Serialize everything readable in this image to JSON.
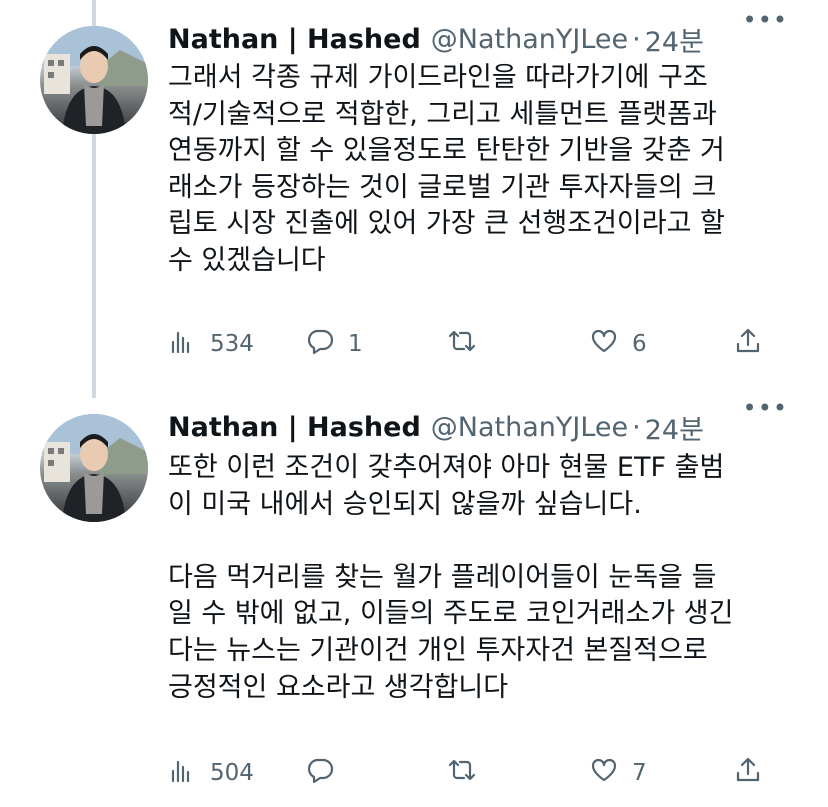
{
  "tweets": [
    {
      "author": {
        "name": "Nathan | Hashed",
        "handle": "@NathanYJLee"
      },
      "separator": "·",
      "time": "24분",
      "text": "그래서 각종 규제 가이드라인을 따라가기에 구조\n적/기술적으로 적합한, 그리고 세틀먼트 플랫폼과\n연동까지 할 수 있을정도로 탄탄한 기반을 갖춘 거\n래소가 등장하는 것이 글로벌 기관 투자자들의 크\n립토 시장 진출에 있어 가장 큰 선행조건이라고 할\n수 있겠습니다",
      "metrics": {
        "views": "534",
        "replies": "1",
        "retweets": "",
        "likes": "6"
      },
      "icons": {
        "views": "bar-chart-icon",
        "reply": "comment-icon",
        "retweet": "retweet-icon",
        "like": "heart-icon",
        "share": "share-icon",
        "more": "more-icon"
      }
    },
    {
      "author": {
        "name": "Nathan | Hashed",
        "handle": "@NathanYJLee"
      },
      "separator": "·",
      "time": "24분",
      "text": "또한 이런 조건이 갖추어져야 아마 현물 ETF 출범\n이 미국 내에서 승인되지 않을까 싶습니다.\n\n다음 먹거리를 찾는 월가 플레이어들이 눈독을 들\n일 수 밖에 없고, 이들의 주도로 코인거래소가 생긴\n다는 뉴스는 기관이건 개인 투자자건 본질적으로\n긍정적인 요소라고 생각합니다",
      "metrics": {
        "views": "504",
        "replies": "",
        "retweets": "",
        "likes": "7"
      },
      "icons": {
        "views": "bar-chart-icon",
        "reply": "comment-icon",
        "retweet": "retweet-icon",
        "like": "heart-icon",
        "share": "share-icon",
        "more": "more-icon"
      }
    }
  ],
  "colors": {
    "text": "#0f1419",
    "secondary": "#536471",
    "thread_line": "#cfd9de",
    "background": "#ffffff"
  }
}
